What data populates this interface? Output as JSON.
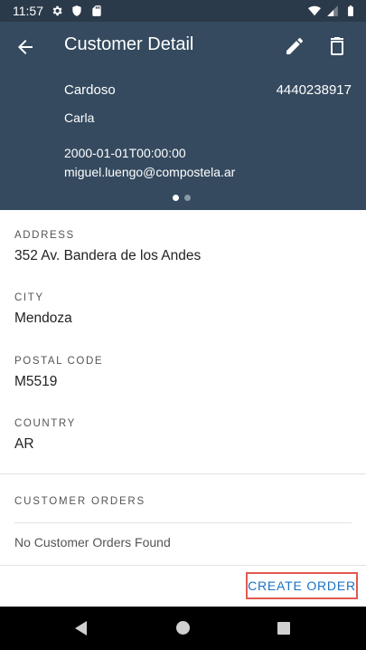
{
  "status_bar": {
    "time": "11:57"
  },
  "header": {
    "title": "Customer Detail",
    "last_name": "Cardoso",
    "first_name": "Carla",
    "phone": "4440238917",
    "birthdate": "2000-01-01T00:00:00",
    "email": "miguel.luengo@compostela.ar"
  },
  "fields": {
    "address_label": "ADDRESS",
    "address_value": "352 Av. Bandera de los Andes",
    "city_label": "CITY",
    "city_value": "Mendoza",
    "postal_label": "POSTAL CODE",
    "postal_value": "M5519",
    "country_label": "COUNTRY",
    "country_value": "AR"
  },
  "orders": {
    "section_label": "CUSTOMER ORDERS",
    "empty_text": "No Customer Orders Found",
    "create_label": "CREATE ORDER"
  },
  "colors": {
    "header_bg": "#354a5f",
    "status_bg": "#2b3a4a",
    "accent": "#1b73c4",
    "highlight": "#e05a50"
  }
}
